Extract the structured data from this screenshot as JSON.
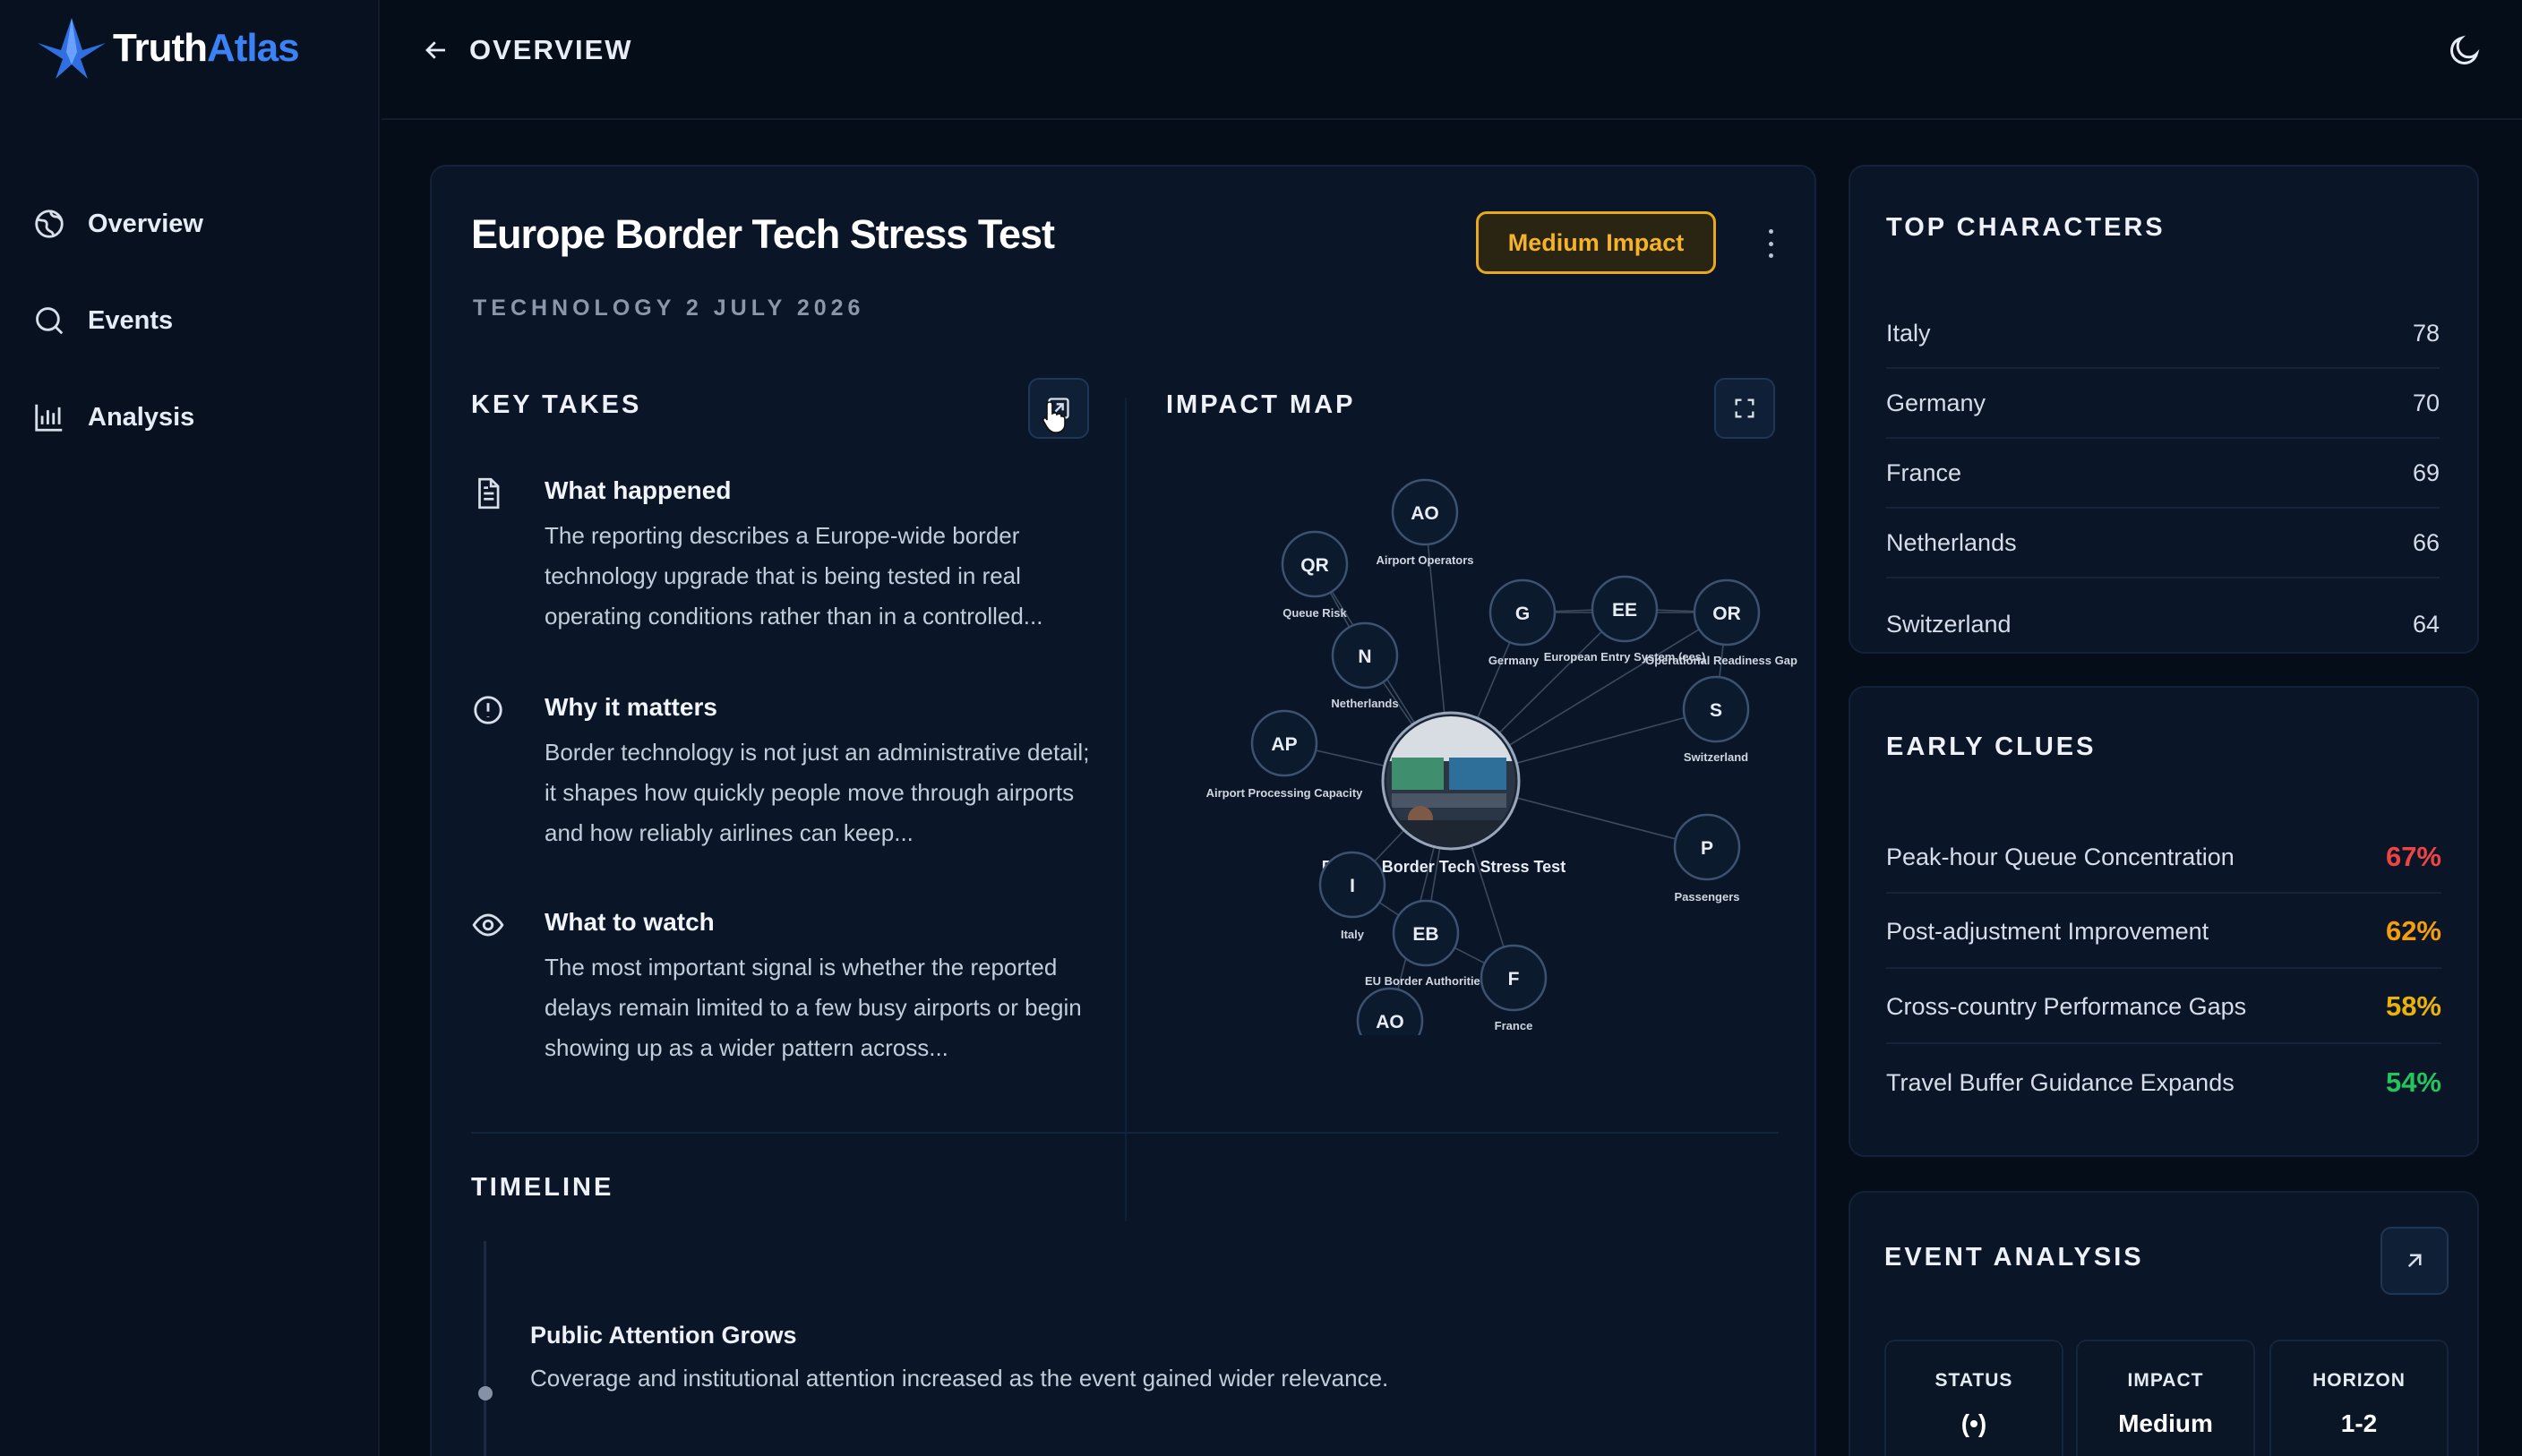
{
  "brand": {
    "name_a": "Truth",
    "name_b": "Atlas"
  },
  "nav": {
    "items": [
      {
        "label": "Overview",
        "icon": "globe-icon"
      },
      {
        "label": "Events",
        "icon": "search-icon"
      },
      {
        "label": "Analysis",
        "icon": "bar-chart-icon"
      }
    ]
  },
  "header": {
    "back_label": "OVERVIEW"
  },
  "event": {
    "title": "Europe Border Tech Stress Test",
    "meta": "TECHNOLOGY 2 JULY 2026",
    "impact_badge": "Medium Impact"
  },
  "key_takes": {
    "heading": "KEY TAKES",
    "items": [
      {
        "title": "What happened",
        "text": "The reporting describes a Europe-wide border technology upgrade that is being tested in real operating conditions rather than in a controlled...",
        "icon": "document-icon"
      },
      {
        "title": "Why it matters",
        "text": "Border technology is not just an administrative detail; it shapes how quickly people move through airports and how reliably airlines can keep...",
        "icon": "alert-circle-icon"
      },
      {
        "title": "What to watch",
        "text": "The most important signal is whether the reported delays remain limited to a few busy airports or begin showing up as a wider pattern across...",
        "icon": "eye-icon"
      }
    ]
  },
  "impact_map": {
    "heading": "IMPACT MAP",
    "center_label": "Europe Border Tech Stress Test",
    "nodes": [
      {
        "abbr": "AO",
        "label": "Airport Operators"
      },
      {
        "abbr": "QR",
        "label": "Queue Risk"
      },
      {
        "abbr": "G",
        "label": "Germany"
      },
      {
        "abbr": "EE",
        "label": "European Entry System (ees)"
      },
      {
        "abbr": "OR",
        "label": "Operational Readiness Gap"
      },
      {
        "abbr": "N",
        "label": "Netherlands"
      },
      {
        "abbr": "S",
        "label": "Switzerland"
      },
      {
        "abbr": "AP",
        "label": "Airport Processing Capacity"
      },
      {
        "abbr": "P",
        "label": "Passengers"
      },
      {
        "abbr": "I",
        "label": "Italy"
      },
      {
        "abbr": "EB",
        "label": "EU Border Authorities"
      },
      {
        "abbr": "F",
        "label": "France"
      },
      {
        "abbr": "AO",
        "label": ""
      }
    ]
  },
  "timeline": {
    "heading": "TIMELINE",
    "items": [
      {
        "title": "Public Attention Grows",
        "text": "Coverage and institutional attention increased as the event gained wider relevance."
      }
    ]
  },
  "top_characters": {
    "heading": "TOP CHARACTERS",
    "items": [
      {
        "name": "Italy",
        "score": "78"
      },
      {
        "name": "Germany",
        "score": "70"
      },
      {
        "name": "France",
        "score": "69"
      },
      {
        "name": "Netherlands",
        "score": "66"
      },
      {
        "name": "Switzerland",
        "score": "64"
      }
    ]
  },
  "early_clues": {
    "heading": "EARLY CLUES",
    "items": [
      {
        "label": "Peak-hour Queue Concentration",
        "pct": "67%",
        "color": "#ef4444"
      },
      {
        "label": "Post-adjustment Improvement",
        "pct": "62%",
        "color": "#f59e0b"
      },
      {
        "label": "Cross-country Performance Gaps",
        "pct": "58%",
        "color": "#eab308"
      },
      {
        "label": "Travel Buffer Guidance Expands",
        "pct": "54%",
        "color": "#22c55e"
      }
    ]
  },
  "event_analysis": {
    "heading": "EVENT ANALYSIS",
    "stats": [
      {
        "label": "STATUS",
        "value": "(•)"
      },
      {
        "label": "IMPACT",
        "value": "Medium"
      },
      {
        "label": "HORIZON",
        "value": "1-2"
      }
    ]
  }
}
